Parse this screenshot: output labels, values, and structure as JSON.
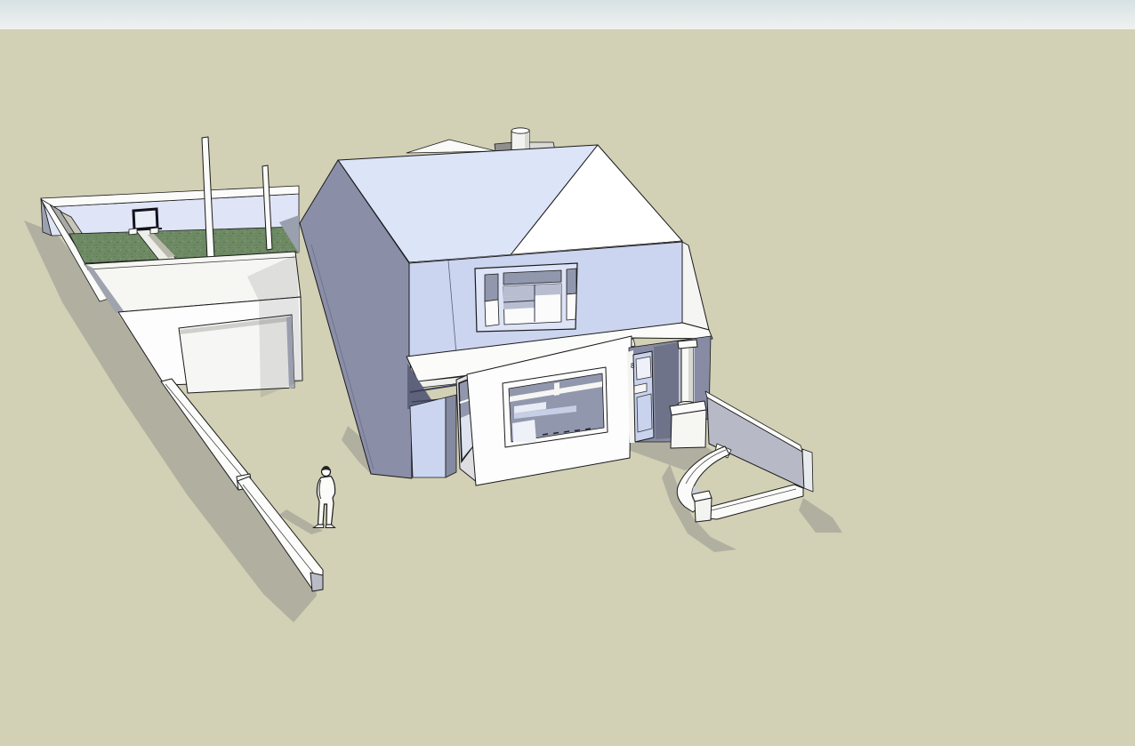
{
  "scene": {
    "door_number": "8",
    "colors": {
      "sky_top": "#d7e1e4",
      "sky_bottom": "#f0f2f1",
      "ground": "#d2d0b5",
      "shadow": "#b1b0a0",
      "grass": "#6d8a64",
      "grass_dark": "#55704d",
      "grass_mid": "#617e58",
      "grass_light": "#7f9c76",
      "wall_white": "#fbfbfa",
      "inner_wall": "#dfe4f6",
      "wall_gray": "#a9a9a5",
      "roof_lavender": "#dce4f8",
      "roof_white": "#ffffff",
      "wall_lavender": "#cbd5f0",
      "gable_dark": "#8a8fa7",
      "frame_lavender": "#dee4f7",
      "glass": "#9197ac",
      "glass_dark": "#8d93a8",
      "recess": "#878ca4",
      "recess_dark": "#6e7389",
      "door_lavender": "#c9d3ee",
      "tall_wall": "#b7bac6",
      "goal_frame": "#13131f"
    }
  }
}
